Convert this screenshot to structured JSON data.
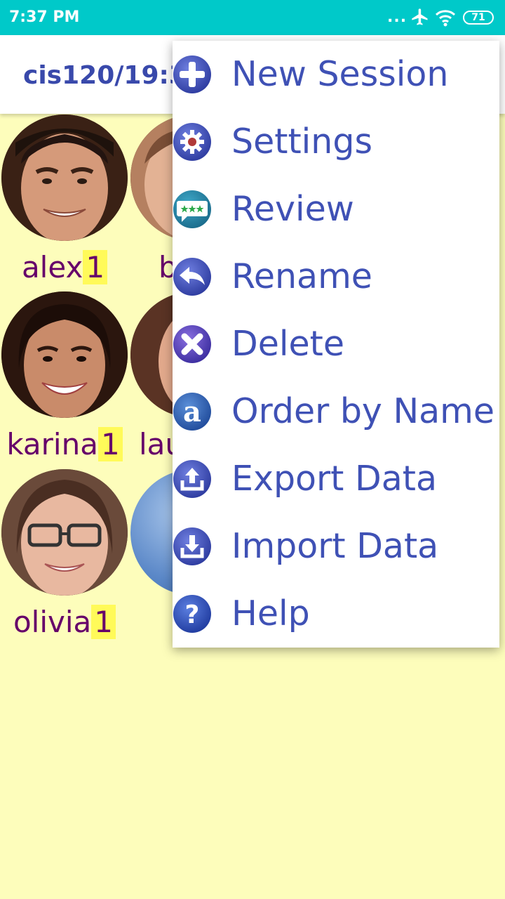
{
  "status_bar": {
    "time": "7:37 PM",
    "dots": "...",
    "battery": "71"
  },
  "app_bar": {
    "title": "cis120/19:3"
  },
  "students": [
    {
      "name": "alex",
      "count": "1"
    },
    {
      "name": "b",
      "count": ""
    },
    {
      "name": "karina",
      "count": "1"
    },
    {
      "name": "lau",
      "count": ""
    },
    {
      "name": "olivia",
      "count": "1"
    }
  ],
  "menu": {
    "items": [
      {
        "label": "New Session",
        "icon": "plus-icon"
      },
      {
        "label": "Settings",
        "icon": "gear-icon"
      },
      {
        "label": "Review",
        "icon": "comment-stars-icon"
      },
      {
        "label": "Rename",
        "icon": "undo-arrow-icon"
      },
      {
        "label": "Delete",
        "icon": "close-icon"
      },
      {
        "label": "Order by Name",
        "icon": "letter-a-icon"
      },
      {
        "label": "Export Data",
        "icon": "upload-icon"
      },
      {
        "label": "Import Data",
        "icon": "download-icon"
      },
      {
        "label": "Help",
        "icon": "question-icon"
      }
    ]
  },
  "colors": {
    "status_bar_bg": "#00c9c9",
    "background": "#fdfdbb",
    "menu_text": "#3f51b5",
    "name_text": "#66006a",
    "count_highlight": "#fffa59"
  }
}
